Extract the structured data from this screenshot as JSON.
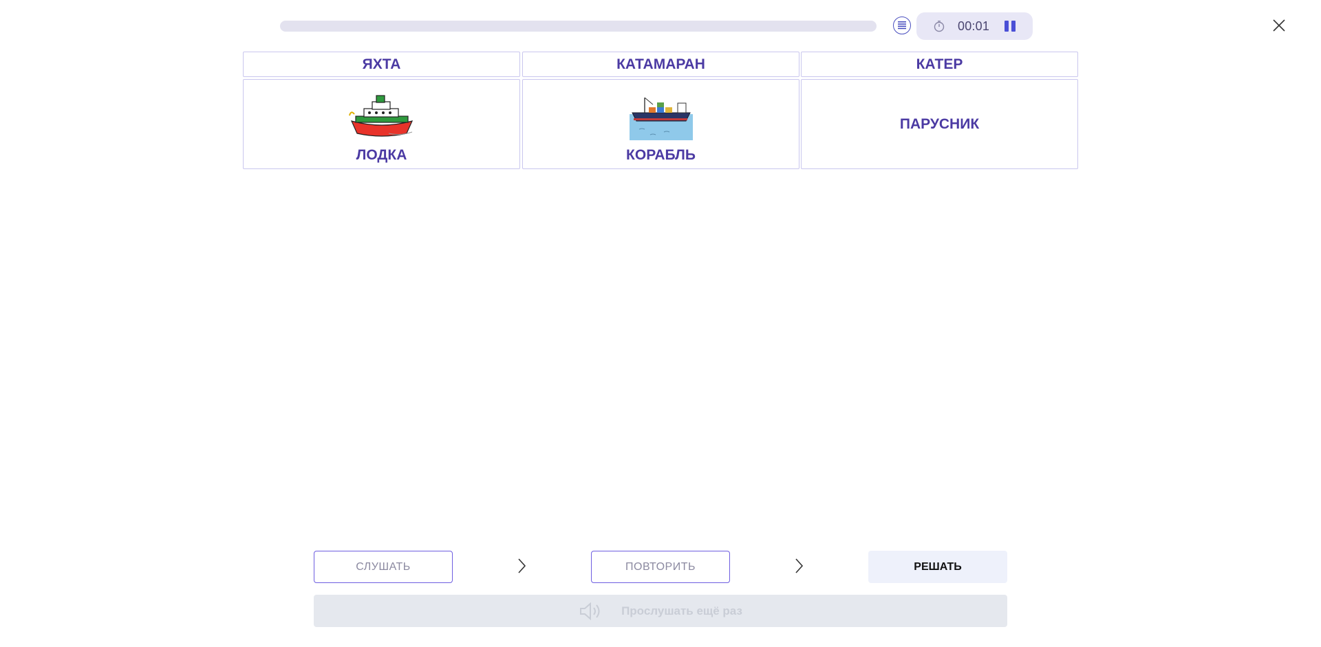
{
  "header": {
    "timer": "00:01",
    "progress": 0
  },
  "columns": [
    {
      "header": "ЯХТА",
      "item_label": "ЛОДКА",
      "item_image": "ferry-boat-icon"
    },
    {
      "header": "КАТАМАРАН",
      "item_label": "КОРАБЛЬ",
      "item_image": "cargo-ship-icon"
    },
    {
      "header": "КАТЕР",
      "item_label": "ПАРУСНИК",
      "item_image": null
    }
  ],
  "controls": {
    "listen_label": "СЛУШАТЬ",
    "repeat_label": "ПОВТОРИТЬ",
    "solve_label": "РЕШАТЬ",
    "listen_again_label": "Прослушать ещё раз"
  },
  "colors": {
    "accent": "#4b3aa3",
    "border": "#c9c6ee",
    "progress_track": "#e3e2ef",
    "timer_bg": "#e8e7f6",
    "disabled_bg": "#e5e8ee"
  },
  "icons": [
    "list-icon",
    "stopwatch-icon",
    "pause-icon",
    "close-icon",
    "chevron-right-icon",
    "speaker-icon"
  ]
}
